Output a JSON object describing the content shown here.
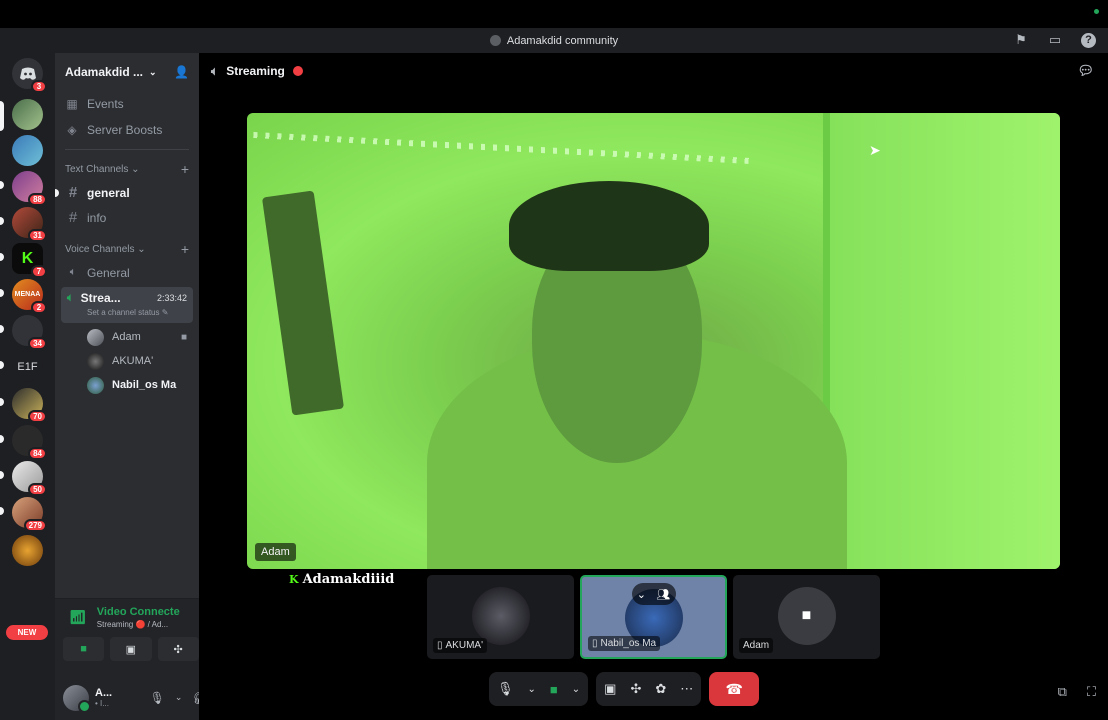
{
  "window": {
    "title": "Adamakdid community"
  },
  "guild_rail": {
    "badges": [
      "3",
      "88",
      "31",
      "7",
      "2",
      "34",
      "70",
      "84",
      "50",
      "279"
    ],
    "text_guild": "E1F",
    "new_label": "NEW"
  },
  "server": {
    "name": "Adamakdid ...",
    "events": "Events",
    "boosts": "Server Boosts",
    "text_category": "Text Channels",
    "text_channels": [
      "general",
      "info"
    ],
    "voice_category": "Voice Channels",
    "voice_general": "General",
    "voice_active_name": "Strea...",
    "voice_active_timer": "2:33:42",
    "voice_active_status": "Set a channel status",
    "voice_users": [
      "Adam",
      "AKUMA'",
      "Nabil_os Ma"
    ]
  },
  "voice_panel": {
    "title": "Video Connecte",
    "sub": "Streaming 🔴 / Ad..."
  },
  "user_panel": {
    "name": "A...",
    "sub": "• I..."
  },
  "stage": {
    "header": "Streaming",
    "main_video_label": "Adam",
    "streamer_name": "Adamakdiiid",
    "tiles": [
      {
        "label": "AKUMA'"
      },
      {
        "label": "Nabil_os Ma"
      },
      {
        "label": "Adam"
      }
    ]
  },
  "colors": {
    "accent_green": "#23a55a",
    "danger_red": "#da373c",
    "kick_green": "#53fc18"
  }
}
